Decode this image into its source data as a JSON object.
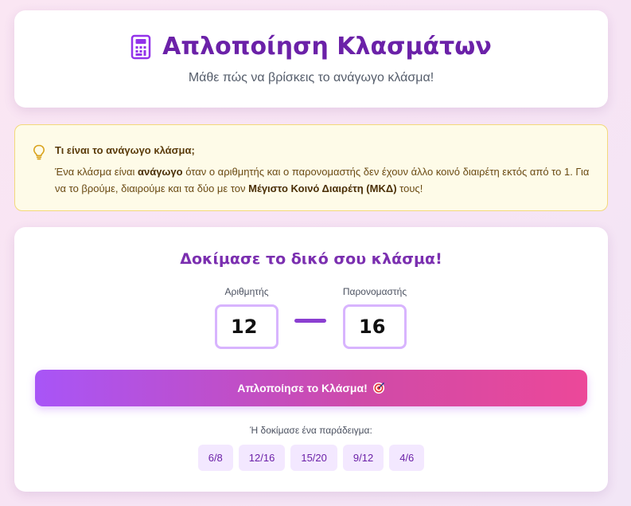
{
  "header": {
    "icon": "calculator-icon",
    "title": "Απλοποίηση Κλασμάτων",
    "subtitle": "Μάθε πώς να βρίσκεις το ανάγωγο κλάσμα!"
  },
  "info": {
    "icon": "lightbulb-icon",
    "title": "Τι είναι το ανάγωγο κλάσμα;",
    "text_1": "Ένα κλάσμα είναι ",
    "bold_1": "ανάγωγο",
    "text_2": " όταν ο αριθμητής και ο παρονομαστής δεν έχουν άλλο κοινό διαιρέτη εκτός από το 1. Για να το βρούμε, διαιρούμε και τα δύο με τον ",
    "bold_2": "Μέγιστο Κοινό Διαιρέτη (ΜΚΔ)",
    "text_3": " τους!"
  },
  "main": {
    "title": "Δοκίμασε το δικό σου κλάσμα!",
    "numerator_label": "Αριθμητής",
    "numerator_value": "12",
    "denominator_label": "Παρονομαστής",
    "denominator_value": "16",
    "button_label": "Απλοποίησε το Κλάσμα!",
    "button_icon": "target-icon",
    "examples_label": "Ή δοκίμασε ένα παράδειγμα:",
    "examples": [
      "6/8",
      "12/16",
      "15/20",
      "9/12",
      "4/6"
    ]
  },
  "colors": {
    "title": "#6b21a8",
    "accent_start": "#a855f7",
    "accent_end": "#ec4899",
    "info_bg": "#fefbe8",
    "chip_bg": "#f3e8ff"
  }
}
